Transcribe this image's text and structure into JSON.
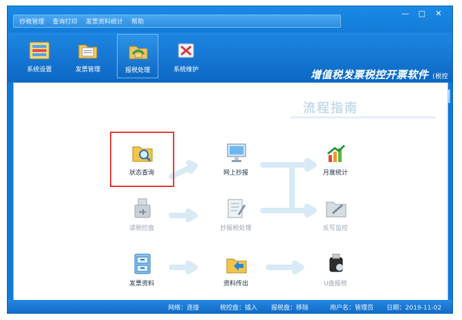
{
  "menu": [
    "抄税管理",
    "查询打印",
    "发票资料统计",
    "帮助"
  ],
  "toolbar": [
    {
      "label": "系统设置",
      "icon": "system-settings-icon"
    },
    {
      "label": "发票管理",
      "icon": "invoice-folder-icon"
    },
    {
      "label": "报税处理",
      "icon": "tax-report-icon"
    },
    {
      "label": "系统维护",
      "icon": "system-maintenance-icon"
    }
  ],
  "brand": {
    "title": "增值税发票税控开票软件",
    "subtitle": "(税控盘版)"
  },
  "guide": {
    "title": "流程指南",
    "nodes": [
      {
        "key": "status_query",
        "label": "状态查询",
        "icon": "folder-search-icon",
        "dim": false
      },
      {
        "key": "online_copy",
        "label": "网上抄报",
        "icon": "monitor-icon",
        "dim": false
      },
      {
        "key": "monthly_stats",
        "label": "月度统计",
        "icon": "growth-chart-icon",
        "dim": false
      },
      {
        "key": "control_disk",
        "label": "读税控盘",
        "icon": "usb-drive-icon",
        "dim": true
      },
      {
        "key": "copy_process",
        "label": "抄报税处理",
        "icon": "document-pen-icon",
        "dim": true
      },
      {
        "key": "anti_monitor",
        "label": "反写监控",
        "icon": "folder-edit-icon",
        "dim": true
      },
      {
        "key": "invoice_data",
        "label": "发票资料",
        "icon": "cabinet-icon",
        "dim": false
      },
      {
        "key": "data_export",
        "label": "资料传出",
        "icon": "folder-export-icon",
        "dim": false
      },
      {
        "key": "usb_tax",
        "label": "U盘报税",
        "icon": "usb-stick-icon",
        "dim": true
      }
    ]
  },
  "status": {
    "network": "网络：连接",
    "disk": "税控盘：插入",
    "report_disk": "报税盘：移除",
    "user": "用户名：管理员",
    "date": "日期：2019-11-02"
  },
  "colors": {
    "accent": "#0f73cf",
    "highlight": "#e43a35",
    "arrow": "#d7eaf5"
  }
}
